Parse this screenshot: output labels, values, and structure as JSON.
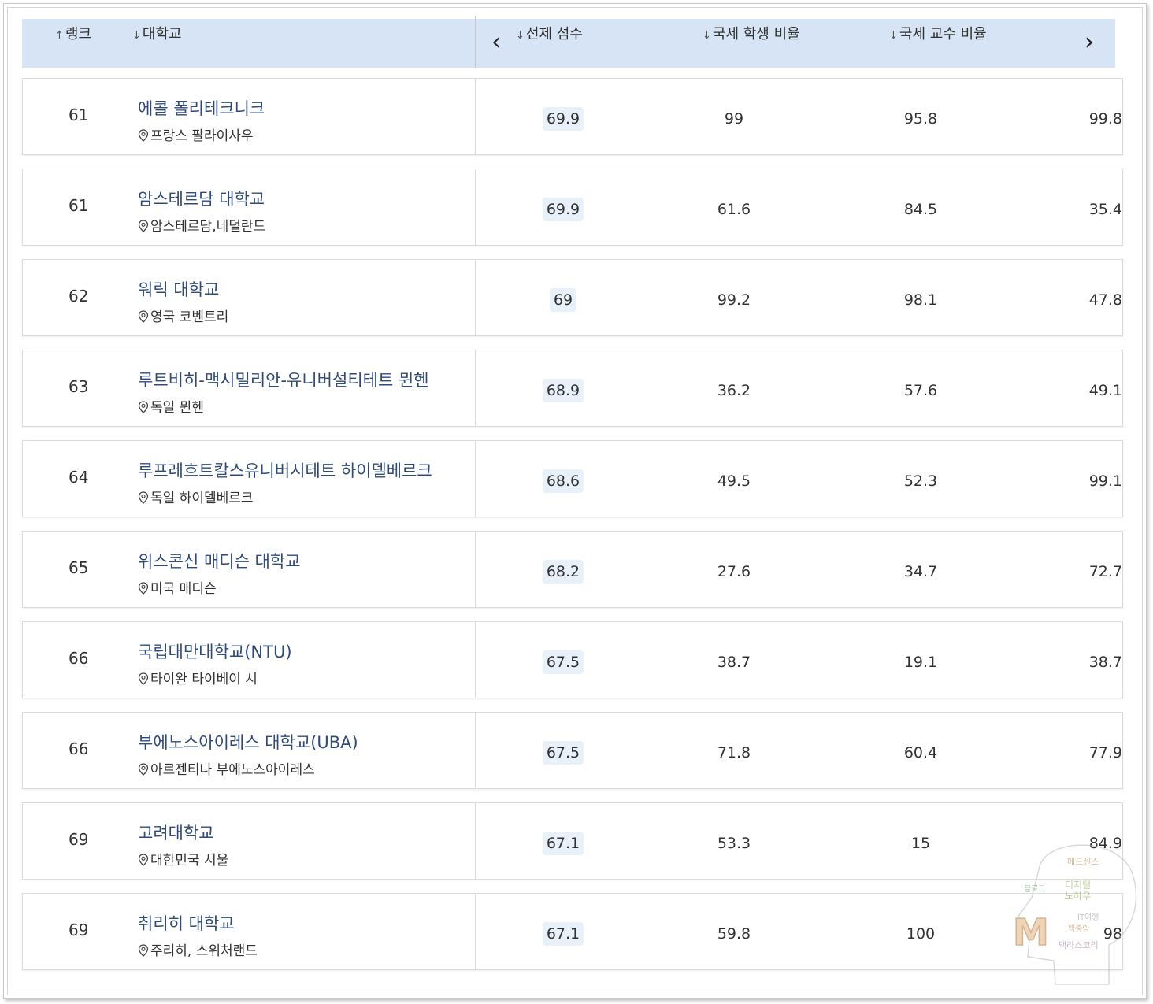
{
  "header": {
    "col_rank": "랭크",
    "col_university": "대학교",
    "col_overall": "선제 섬수",
    "col_intl_students": "국세 학생 비율",
    "col_intl_faculty": "국세 교수 비율",
    "sort_up": "↑",
    "sort_down": "↓",
    "prev": "‹",
    "next": "›"
  },
  "rows": [
    {
      "rank": "61",
      "name": "에콜 폴리테크니크",
      "location": "프랑스 팔라이사우",
      "overall": "69.9",
      "intl_students": "99",
      "intl_faculty": "95.8",
      "next_col": "99.8"
    },
    {
      "rank": "61",
      "name": "암스테르담 대학교",
      "location": "암스테르담,네덜란드",
      "overall": "69.9",
      "intl_students": "61.6",
      "intl_faculty": "84.5",
      "next_col": "35.4"
    },
    {
      "rank": "62",
      "name": "워릭 대학교",
      "location": "영국 코벤트리",
      "overall": "69",
      "intl_students": "99.2",
      "intl_faculty": "98.1",
      "next_col": "47.8"
    },
    {
      "rank": "63",
      "name": "루트비히-맥시밀리안-유니버설티테트 뮌헨",
      "location": "독일 뮌헨",
      "overall": "68.9",
      "intl_students": "36.2",
      "intl_faculty": "57.6",
      "next_col": "49.1"
    },
    {
      "rank": "64",
      "name": "루프레흐트칼스유니버시테트 하이델베르크",
      "location": "독일 하이델베르크",
      "overall": "68.6",
      "intl_students": "49.5",
      "intl_faculty": "52.3",
      "next_col": "99.1"
    },
    {
      "rank": "65",
      "name": "위스콘신 매디슨 대학교",
      "location": "미국 매디슨",
      "overall": "68.2",
      "intl_students": "27.6",
      "intl_faculty": "34.7",
      "next_col": "72.7"
    },
    {
      "rank": "66",
      "name": "국립대만대학교(NTU)",
      "location": "타이완 타이베이 시",
      "overall": "67.5",
      "intl_students": "38.7",
      "intl_faculty": "19.1",
      "next_col": "38.7"
    },
    {
      "rank": "66",
      "name": "부에노스아이레스 대학교(UBA)",
      "location": "아르젠티나 부에노스아이레스",
      "overall": "67.5",
      "intl_students": "71.8",
      "intl_faculty": "60.4",
      "next_col": "77.9"
    },
    {
      "rank": "69",
      "name": "고려대학교",
      "location": "대한민국 서울",
      "overall": "67.1",
      "intl_students": "53.3",
      "intl_faculty": "15",
      "next_col": "84.9"
    },
    {
      "rank": "69",
      "name": "취리히 대학교",
      "location": "주리히, 스위처랜드",
      "overall": "67.1",
      "intl_students": "59.8",
      "intl_faculty": "100",
      "next_col": "98"
    }
  ],
  "watermark": {
    "letter": "M",
    "words": [
      "메드센스",
      "블로그",
      "디지털",
      "노하우",
      "IT여행",
      "맥중앙",
      "맥라스코리"
    ]
  },
  "colors": {
    "header_bg": "#d6e4f5",
    "score_badge_bg": "#e8f0fa",
    "link_text": "#2f4b7c"
  }
}
